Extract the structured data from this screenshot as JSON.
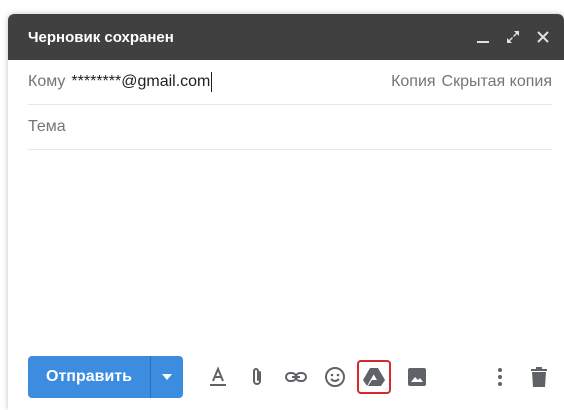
{
  "compose": {
    "title": "Черновик сохранен",
    "controls": {
      "minimize": "minimize-icon",
      "expand": "expand-icon",
      "close": "close-icon"
    },
    "to": {
      "label": "Кому",
      "value": "********@gmail.com"
    },
    "cc_label": "Копия",
    "bcc_label": "Скрытая копия",
    "subject": {
      "placeholder": "Тема",
      "value": ""
    },
    "body": {
      "value": ""
    }
  },
  "toolbar": {
    "send_label": "Отправить",
    "send_options_icon": "caret-down-icon",
    "tools": [
      "text-format-icon",
      "attach-icon",
      "link-icon",
      "emoji-icon",
      "google-drive-icon",
      "insert-photo-icon",
      "more-options-icon",
      "trash-icon"
    ],
    "highlighted_tool": "google-drive-icon"
  },
  "colors": {
    "titlebar": "#404040",
    "send_button": "#3c8de0",
    "highlight_border": "#d12b2b",
    "icon": "#5f6368"
  }
}
